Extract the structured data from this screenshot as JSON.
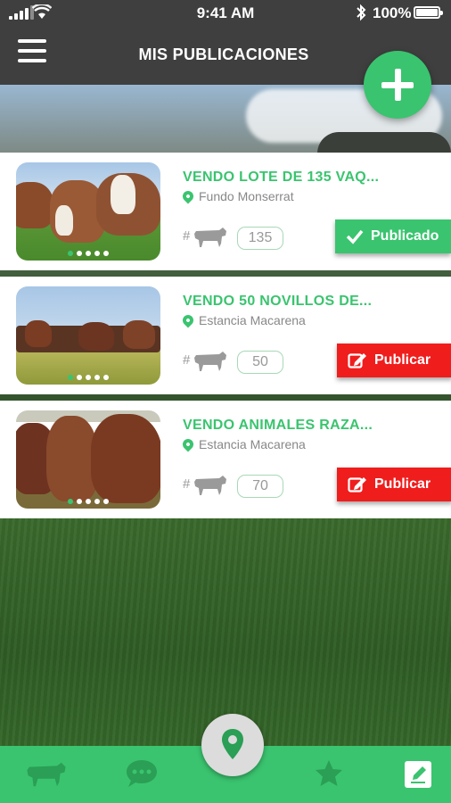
{
  "status_bar": {
    "time": "9:41 AM",
    "battery": "100%"
  },
  "header": {
    "title": "MIS PUBLICACIONES"
  },
  "publications": [
    {
      "title": "VENDO LOTE DE 135 VAQ...",
      "location": "Fundo Monserrat",
      "hash": "#",
      "count": "135",
      "status_label": "Publicado",
      "status": "published"
    },
    {
      "title": "VENDO 50 NOVILLOS DE...",
      "location": "Estancia Macarena",
      "hash": "#",
      "count": "50",
      "status_label": "Publicar",
      "status": "unpublished"
    },
    {
      "title": "VENDO ANIMALES RAZA...",
      "location": "Estancia Macarena",
      "hash": "#",
      "count": "70",
      "status_label": "Publicar",
      "status": "unpublished"
    }
  ],
  "colors": {
    "accent": "#3ac46f",
    "danger": "#f01d1d",
    "header": "#3f3f3f"
  },
  "bottom_nav": {
    "icons": [
      "cow-icon",
      "chat-icon",
      "map-pin-icon",
      "star-icon",
      "edit-icon"
    ]
  }
}
